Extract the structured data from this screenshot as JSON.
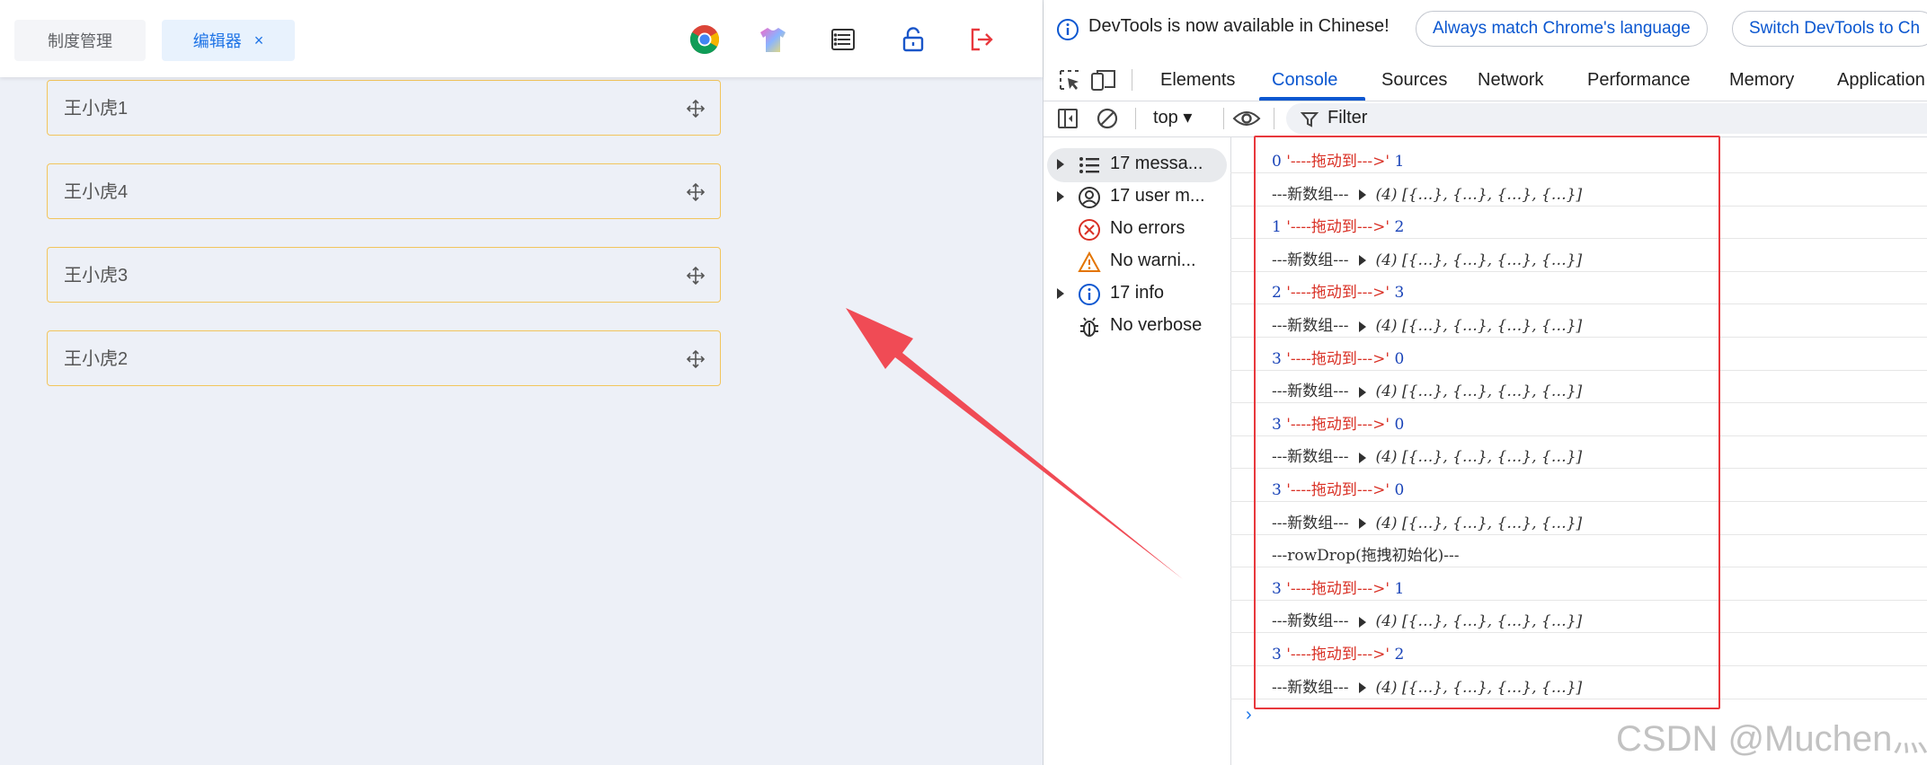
{
  "app": {
    "tabs": [
      {
        "label": "制度管理"
      },
      {
        "label": "编辑器",
        "close": "×"
      }
    ],
    "header_icons": [
      "chrome-icon",
      "tshirt-icon",
      "list-icon",
      "unlock-icon",
      "logout-icon"
    ],
    "items": [
      {
        "label": "王小虎1"
      },
      {
        "label": "王小虎4"
      },
      {
        "label": "王小虎3"
      },
      {
        "label": "王小虎2"
      }
    ]
  },
  "devtools": {
    "notice": {
      "message": "DevTools is now available in Chinese!",
      "match_button": "Always match Chrome's language",
      "switch_button": "Switch DevTools to Ch"
    },
    "tabs": [
      "Elements",
      "Console",
      "Sources",
      "Network",
      "Performance",
      "Memory",
      "Application"
    ],
    "active_tab": "Console",
    "toolbar": {
      "context": "top ▾",
      "filter": "Filter"
    },
    "sidebar": [
      {
        "label": "17 messa...",
        "icon": "list-icon"
      },
      {
        "label": "17 user m...",
        "icon": "user-icon"
      },
      {
        "label": "No errors",
        "icon": "error-icon"
      },
      {
        "label": "No warni...",
        "icon": "warning-icon"
      },
      {
        "label": "17 info",
        "icon": "info-icon"
      },
      {
        "label": "No verbose",
        "icon": "bug-icon"
      }
    ],
    "console_rows": [
      {
        "type": "move",
        "from": "0",
        "text": "'----拖动到--->'",
        "to": "1"
      },
      {
        "type": "array",
        "label": "---新数组---",
        "count": "(4)",
        "preview": "[{…}, {…}, {…}, {…}]"
      },
      {
        "type": "move",
        "from": "1",
        "text": "'----拖动到--->'",
        "to": "2"
      },
      {
        "type": "array",
        "label": "---新数组---",
        "count": "(4)",
        "preview": "[{…}, {…}, {…}, {…}]"
      },
      {
        "type": "move",
        "from": "2",
        "text": "'----拖动到--->'",
        "to": "3"
      },
      {
        "type": "array",
        "label": "---新数组---",
        "count": "(4)",
        "preview": "[{…}, {…}, {…}, {…}]"
      },
      {
        "type": "move",
        "from": "3",
        "text": "'----拖动到--->'",
        "to": "0"
      },
      {
        "type": "array",
        "label": "---新数组---",
        "count": "(4)",
        "preview": "[{…}, {…}, {…}, {…}]"
      },
      {
        "type": "move",
        "from": "3",
        "text": "'----拖动到--->'",
        "to": "0"
      },
      {
        "type": "array",
        "label": "---新数组---",
        "count": "(4)",
        "preview": "[{…}, {…}, {…}, {…}]"
      },
      {
        "type": "move",
        "from": "3",
        "text": "'----拖动到--->'",
        "to": "0"
      },
      {
        "type": "array",
        "label": "---新数组---",
        "count": "(4)",
        "preview": "[{…}, {…}, {…}, {…}]"
      },
      {
        "type": "text",
        "text": "---rowDrop(拖拽初始化)---"
      },
      {
        "type": "move",
        "from": "3",
        "text": "'----拖动到--->'",
        "to": "1"
      },
      {
        "type": "array",
        "label": "---新数组---",
        "count": "(4)",
        "preview": "[{…}, {…}, {…}, {…}]"
      },
      {
        "type": "move",
        "from": "3",
        "text": "'----拖动到--->'",
        "to": "2"
      },
      {
        "type": "array",
        "label": "---新数组---",
        "count": "(4)",
        "preview": "[{…}, {…}, {…}, {…}]"
      }
    ],
    "prompt": "›"
  },
  "watermark": "CSDN @Muchen灬",
  "colors": {
    "accent": "#0b57d0",
    "annotation": "#f04b55",
    "item_border": "#f2c55c"
  }
}
